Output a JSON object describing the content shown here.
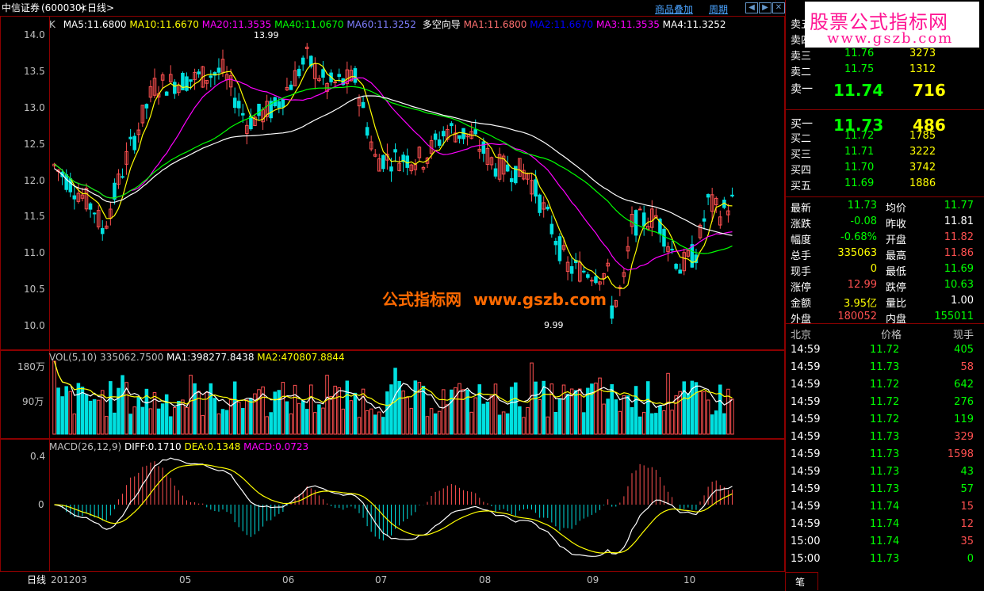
{
  "header": {
    "stock_name": "中信证券",
    "stock_code": "(600030)",
    "period": "<日线>",
    "link_overlay": "商品叠加",
    "link_period": "周期"
  },
  "watermark": {
    "brand_main": "股票公式指标网",
    "brand_url": "www.gszb.com",
    "center_text": "公式指标网",
    "center_url": "www.gszb.com"
  },
  "main_chart": {
    "k_label": "K",
    "ma5": "MA5:11.6800",
    "ma10": "MA10:11.6670",
    "ma20": "MA20:11.3535",
    "ma40": "MA40:11.0670",
    "ma60": "MA60:11.3252",
    "indicator": "多空向导",
    "ma1": "MA1:11.6800",
    "ma2": "MA2:11.6670",
    "ma3": "MA3:11.3535",
    "ma4": "MA4:11.3252",
    "y_ticks": [
      "14.0",
      "13.5",
      "13.0",
      "12.5",
      "12.0",
      "11.5",
      "11.0",
      "10.5",
      "10.0"
    ],
    "high_label": "13.99",
    "low_label": "9.99",
    "colors": {
      "ma5": "#ffffff",
      "ma10": "#ffff00",
      "ma20": "#ff00ff",
      "ma40": "#00ff00",
      "ma60": "#7f7fff",
      "up": "#ff5050",
      "down": "#00e0e0"
    }
  },
  "volume_chart": {
    "title": "VOL(5,10)",
    "value": "335062.7500",
    "ma1": "MA1:398277.8438",
    "ma2": "MA2:470807.8844",
    "y_ticks": [
      "180万",
      "90万"
    ]
  },
  "macd_chart": {
    "title": "MACD(26,12,9)",
    "diff": "DIFF:0.1710",
    "dea": "DEA:0.1348",
    "macd": "MACD:0.0723",
    "y_ticks": [
      "0.4",
      "0"
    ]
  },
  "x_axis": {
    "label": "日线",
    "ticks": [
      "201203",
      "05",
      "06",
      "07",
      "08",
      "09",
      "10"
    ]
  },
  "order_book": {
    "sell": [
      {
        "label": "卖五",
        "price": "",
        "vol": ""
      },
      {
        "label": "卖四",
        "price": "",
        "vol": ""
      },
      {
        "label": "卖三",
        "price": "11.76",
        "vol": "3273"
      },
      {
        "label": "卖二",
        "price": "11.75",
        "vol": "1312"
      },
      {
        "label": "卖一",
        "price": "11.74",
        "vol": "716"
      }
    ],
    "buy": [
      {
        "label": "买一",
        "price": "11.73",
        "vol": "486"
      },
      {
        "label": "买二",
        "price": "11.72",
        "vol": "1785"
      },
      {
        "label": "买三",
        "price": "11.71",
        "vol": "3222"
      },
      {
        "label": "买四",
        "price": "11.70",
        "vol": "3742"
      },
      {
        "label": "买五",
        "price": "11.69",
        "vol": "1886"
      }
    ]
  },
  "quote": [
    {
      "l1": "最新",
      "v1": "11.73",
      "c1": "#00ff00",
      "l2": "均价",
      "v2": "11.77",
      "c2": "#00ff00"
    },
    {
      "l1": "涨跌",
      "v1": "-0.08",
      "c1": "#00ff00",
      "l2": "昨收",
      "v2": "11.81",
      "c2": "#ffffff"
    },
    {
      "l1": "幅度",
      "v1": "-0.68%",
      "c1": "#00ff00",
      "l2": "开盘",
      "v2": "11.82",
      "c2": "#ff5050"
    },
    {
      "l1": "总手",
      "v1": "335063",
      "c1": "#ffff00",
      "l2": "最高",
      "v2": "11.86",
      "c2": "#ff5050"
    },
    {
      "l1": "现手",
      "v1": "0",
      "c1": "#ffff00",
      "l2": "最低",
      "v2": "11.69",
      "c2": "#00ff00"
    },
    {
      "l1": "涨停",
      "v1": "12.99",
      "c1": "#ff5050",
      "l2": "跌停",
      "v2": "10.63",
      "c2": "#00ff00"
    },
    {
      "l1": "金额",
      "v1": "3.95亿",
      "c1": "#ffff00",
      "l2": "量比",
      "v2": "1.00",
      "c2": "#ffffff"
    },
    {
      "l1": "外盘",
      "v1": "180052",
      "c1": "#ff5050",
      "l2": "内盘",
      "v2": "155011",
      "c2": "#00ff00"
    }
  ],
  "ticks_header": {
    "place": "北京",
    "price": "价格",
    "vol": "现手"
  },
  "ticks": [
    {
      "time": "14:59",
      "price": "11.72",
      "vol": "405",
      "vc": "#00ff00"
    },
    {
      "time": "14:59",
      "price": "11.73",
      "vol": "58",
      "vc": "#ff5050"
    },
    {
      "time": "14:59",
      "price": "11.72",
      "vol": "642",
      "vc": "#00ff00"
    },
    {
      "time": "14:59",
      "price": "11.72",
      "vol": "276",
      "vc": "#00ff00"
    },
    {
      "time": "14:59",
      "price": "11.72",
      "vol": "119",
      "vc": "#00ff00"
    },
    {
      "time": "14:59",
      "price": "11.73",
      "vol": "329",
      "vc": "#ff5050"
    },
    {
      "time": "14:59",
      "price": "11.73",
      "vol": "1598",
      "vc": "#ff5050"
    },
    {
      "time": "14:59",
      "price": "11.73",
      "vol": "43",
      "vc": "#00ff00"
    },
    {
      "time": "14:59",
      "price": "11.73",
      "vol": "57",
      "vc": "#00ff00"
    },
    {
      "time": "14:59",
      "price": "11.74",
      "vol": "15",
      "vc": "#ff5050"
    },
    {
      "time": "14:59",
      "price": "11.74",
      "vol": "12",
      "vc": "#ff5050"
    },
    {
      "time": "15:00",
      "price": "11.74",
      "vol": "35",
      "vc": "#ff5050"
    },
    {
      "time": "15:00",
      "price": "11.73",
      "vol": "0",
      "vc": "#00ff00"
    }
  ],
  "bottom_tab": "笔"
}
